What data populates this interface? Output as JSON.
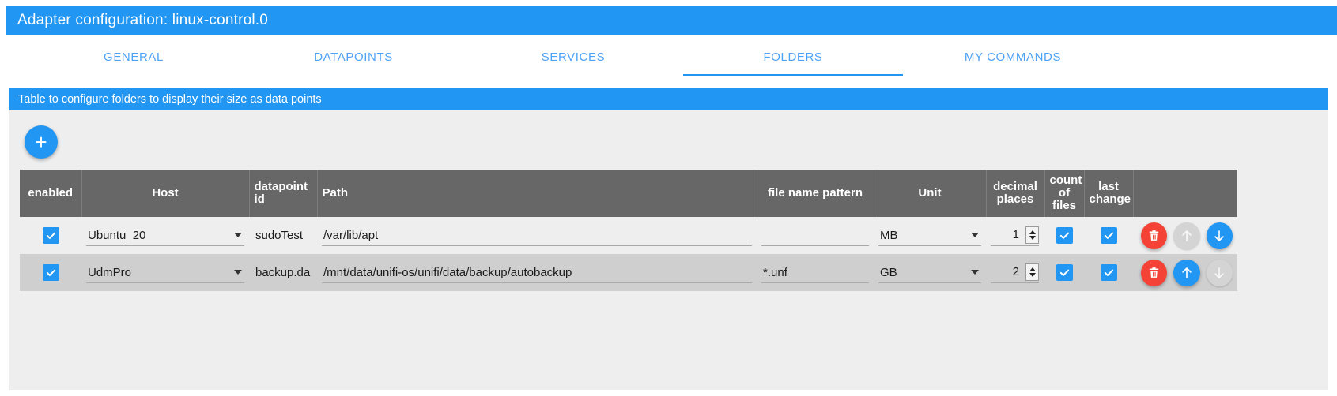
{
  "window": {
    "title": "Adapter configuration: linux-control.0",
    "accent_color": "#2196f3",
    "header_bg": "#676767"
  },
  "tabs": [
    {
      "label": "GENERAL",
      "active": false
    },
    {
      "label": "DATAPOINTS",
      "active": false
    },
    {
      "label": "SERVICES",
      "active": false
    },
    {
      "label": "FOLDERS",
      "active": true
    },
    {
      "label": "MY COMMANDS",
      "active": false
    }
  ],
  "banner": {
    "text": "Table to configure folders to display their size as data points"
  },
  "toolbar": {
    "add_label": "+"
  },
  "table": {
    "columns": [
      {
        "key": "enabled",
        "label": "enabled"
      },
      {
        "key": "host",
        "label": "Host"
      },
      {
        "key": "dpid",
        "label": "datapoint id"
      },
      {
        "key": "path",
        "label": "Path"
      },
      {
        "key": "pattern",
        "label": "file name pattern"
      },
      {
        "key": "unit",
        "label": "Unit"
      },
      {
        "key": "decimals",
        "label": "decimal places"
      },
      {
        "key": "count",
        "label": "count of files"
      },
      {
        "key": "last",
        "label": "last change"
      },
      {
        "key": "actions",
        "label": ""
      }
    ],
    "rows": [
      {
        "enabled": true,
        "host": "Ubuntu_20",
        "dpid": "sudoTest",
        "path": "/var/lib/apt",
        "pattern": "",
        "unit": "MB",
        "decimals": "1",
        "count_of_files": true,
        "last_change": true,
        "move_up_enabled": false,
        "move_down_enabled": true
      },
      {
        "enabled": true,
        "host": "UdmPro",
        "dpid": "backup.da",
        "path": "/mnt/data/unifi-os/unifi/data/backup/autobackup",
        "pattern": "*.unf",
        "unit": "GB",
        "decimals": "2",
        "count_of_files": true,
        "last_change": true,
        "move_up_enabled": true,
        "move_down_enabled": false
      }
    ]
  }
}
